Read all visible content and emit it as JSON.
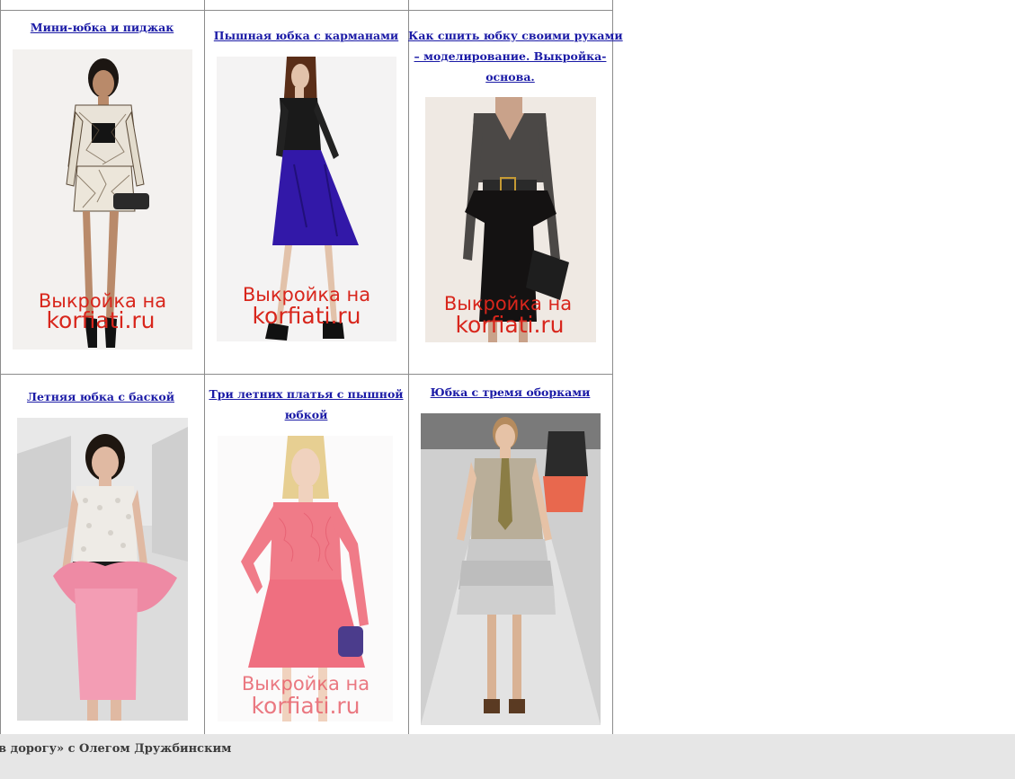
{
  "cells": [
    {
      "title_lines": [
        "Мини-юбка и пиджак"
      ],
      "watermark": [
        "Выкройка на",
        "korfiati.ru"
      ],
      "image_alt": "mini-skirt-and-jacket-photo"
    },
    {
      "title_lines": [
        "Пышная юбка с карманами"
      ],
      "watermark": [
        "Выкройка на",
        "korfiati.ru"
      ],
      "image_alt": "full-skirt-with-pockets-photo"
    },
    {
      "title_lines": [
        "Как сшить юбку своими руками",
        "– моделирование. Выкройка-",
        "основа."
      ],
      "watermark": [
        "Выкройка на",
        "korfiati.ru"
      ],
      "image_alt": "skirt-base-pattern-photo"
    },
    {
      "title_lines": [
        "Летняя юбка с баской"
      ],
      "image_alt": "summer-peplum-skirt-photo"
    },
    {
      "title_lines": [
        "Три летних платья с пышной",
        "юбкой"
      ],
      "watermark": [
        "Выкройка на",
        "korfiati.ru"
      ],
      "image_alt": "pink-lace-dress-photo"
    },
    {
      "title_lines": [
        "Юбка с тремя оборками"
      ],
      "image_alt": "three-ruffle-skirt-runway-photo"
    }
  ],
  "footer": {
    "text": "в дорогу» с Олегом Дружбинским"
  },
  "colors": {
    "link": "#1a1aa6",
    "border": "#8c8c8c",
    "footer_bg": "#e6e6e6",
    "watermark": "#d8261c"
  }
}
